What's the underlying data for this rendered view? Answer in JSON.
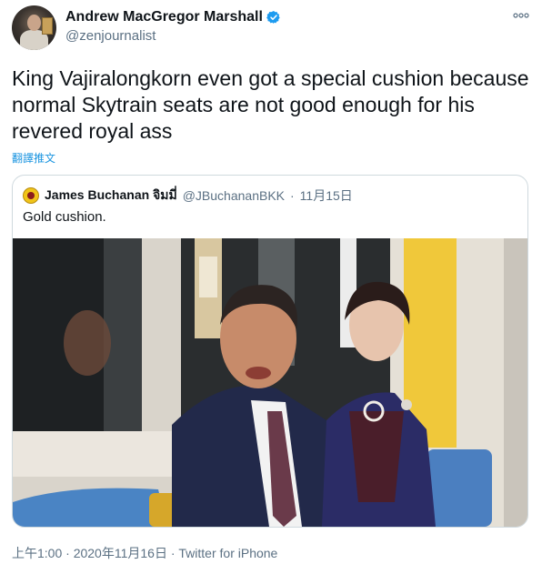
{
  "author": {
    "display_name": "Andrew MacGregor Marshall",
    "handle": "@zenjournalist"
  },
  "tweet": {
    "text": "King Vajiralongkorn even got a special cushion because normal Skytrain seats are not good enough for his revered royal ass",
    "translate_label": "翻譯推文"
  },
  "quoted": {
    "display_name": "James Buchanan จิมมี่",
    "handle": "@JBuchananBKK",
    "separator": "·",
    "date": "11月15日",
    "text": "Gold cushion."
  },
  "meta": {
    "time": "上午1:00",
    "separator1": "·",
    "date": "2020年11月16日",
    "separator2": "·",
    "source": "Twitter for iPhone"
  },
  "icons": {
    "more": "more-horizontal-icon",
    "verified": "verified-badge-icon"
  },
  "colors": {
    "link": "#1b95e0",
    "verified": "#1d9bf0",
    "secondary_text": "#5b7083"
  }
}
